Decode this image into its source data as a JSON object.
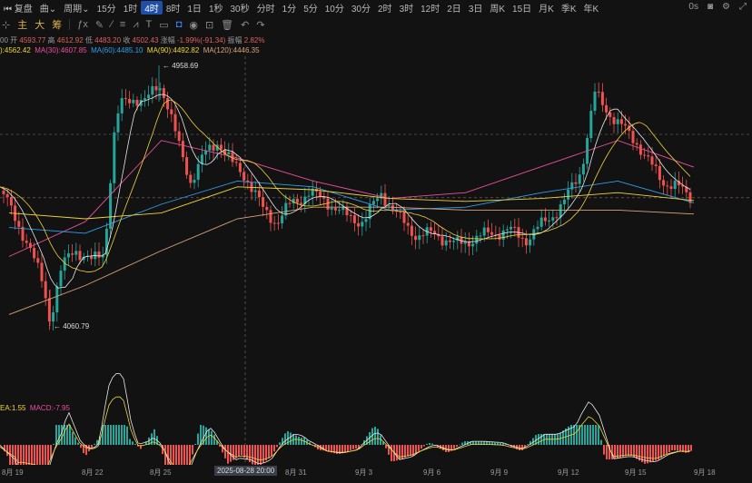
{
  "toolbar": {
    "left_label": "复盘",
    "chart_type": "曲",
    "period_label": "周期",
    "intervals": [
      "15分",
      "1时",
      "4时",
      "8时",
      "1日",
      "1秒",
      "30秒",
      "分时",
      "1分",
      "5分",
      "10分",
      "30分",
      "2时",
      "3时",
      "12时",
      "2日",
      "3日",
      "周K",
      "15日",
      "月K",
      "季K",
      "年K"
    ],
    "active_interval": "4时",
    "right_label": "0s"
  },
  "tools": {
    "main": "主",
    "big": "大",
    "chip": "筹"
  },
  "ohlc": {
    "time": "00",
    "open_label": "开",
    "open": "4593.77",
    "high_label": "高",
    "high": "4612.92",
    "low_label": "低",
    "low": "4483.20",
    "close_label": "收",
    "close": "4502.43",
    "change_label": "涨幅",
    "change": "-1.99%(-91.34)",
    "amp_label": "振幅",
    "amp": "2.82%"
  },
  "ma": {
    "ma_a": "):4562.42",
    "ma30": "MA(30):4607.85",
    "ma60": "MA(60):4485.10",
    "ma90": "MA(90):4492.82",
    "ma120": "MA(120):4446.35"
  },
  "annotations": {
    "high": "4958.69",
    "low": "4060.79"
  },
  "macd": {
    "dea": "EA:1.55",
    "macd": "MACD:-7.95"
  },
  "xaxis": {
    "labels": [
      "8月 19",
      "8月 22",
      "8月 25",
      "8月 31",
      "9月 3",
      "9月 6",
      "9月 9",
      "9月 12",
      "9月 15",
      "9月 18"
    ],
    "crosshair": "2025-08-28 20:00"
  },
  "colors": {
    "up": "#26a69a",
    "down": "#ef5350",
    "ma_white": "#e8e8e8",
    "ma_yellow": "#f0d43a",
    "ma_pink": "#ea4f9c",
    "ma_blue": "#2f9ee8",
    "ma_tan": "#d9a37a",
    "accent": "#1f4fa8"
  },
  "chart_data": {
    "type": "line",
    "xlabel": "",
    "ylabel": "",
    "x": [
      "8月 19",
      "8月 22",
      "8月 25",
      "8月 31",
      "9月 3",
      "9月 6",
      "9月 9",
      "9月 12",
      "9月 15",
      "9月 18"
    ],
    "series": [
      {
        "name": "MA(30)",
        "values": [
          4300,
          4420,
          4700,
          4640,
          4560,
          4500,
          4520,
          4610,
          4700,
          4607.85
        ]
      },
      {
        "name": "MA(60)",
        "values": [
          4400,
          4380,
          4480,
          4560,
          4540,
          4460,
          4470,
          4520,
          4560,
          4485.1
        ]
      },
      {
        "name": "MA(90)",
        "values": [
          4450,
          4430,
          4450,
          4540,
          4530,
          4500,
          4490,
          4500,
          4520,
          4492.82
        ]
      },
      {
        "name": "MA(120)",
        "values": [
          4100,
          4200,
          4320,
          4430,
          4470,
          4470,
          4460,
          4460,
          4460,
          4446.35
        ]
      }
    ],
    "high": 4958.69,
    "low": 4060.79,
    "last_close": 4502.43,
    "legend": "top-left",
    "grid": false
  }
}
